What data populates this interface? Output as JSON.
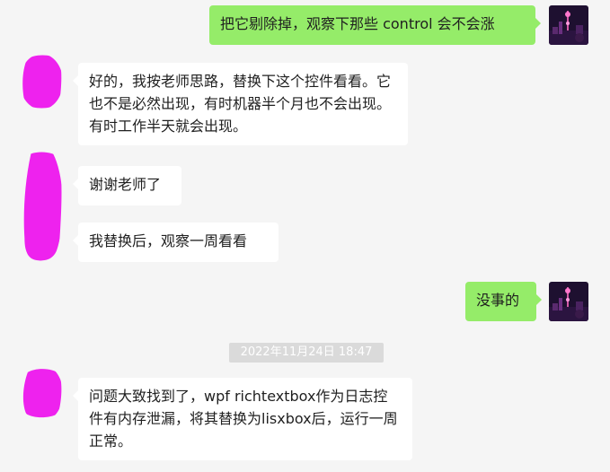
{
  "messages": [
    {
      "side": "out",
      "text": "把它剔除掉，观察下那些 control 会不会涨"
    },
    {
      "side": "in",
      "text": "好的，我按老师思路，替换下这个控件看看。它也不是必然出现，有时机器半个月也不会出现。有时工作半天就会出现。"
    },
    {
      "side": "in",
      "text": "谢谢老师了"
    },
    {
      "side": "in",
      "text": "我替换后，观察一周看看"
    },
    {
      "side": "out",
      "text": "没事的"
    },
    {
      "side": "in",
      "text": "问题大致找到了，wpf richtextbox作为日志控件有内存泄漏，将其替换为lisxbox后，运行一周正常。"
    }
  ],
  "timestamp": "2022年11月24日 18:47",
  "colors": {
    "background": "#f5f5f5",
    "outgoing_bubble": "#95ec69",
    "incoming_bubble": "#ffffff",
    "redaction": "#ee22ee"
  },
  "icons": {
    "self_avatar": "avatar-city-night-icon",
    "other_avatar": "redacted-avatar-icon"
  }
}
